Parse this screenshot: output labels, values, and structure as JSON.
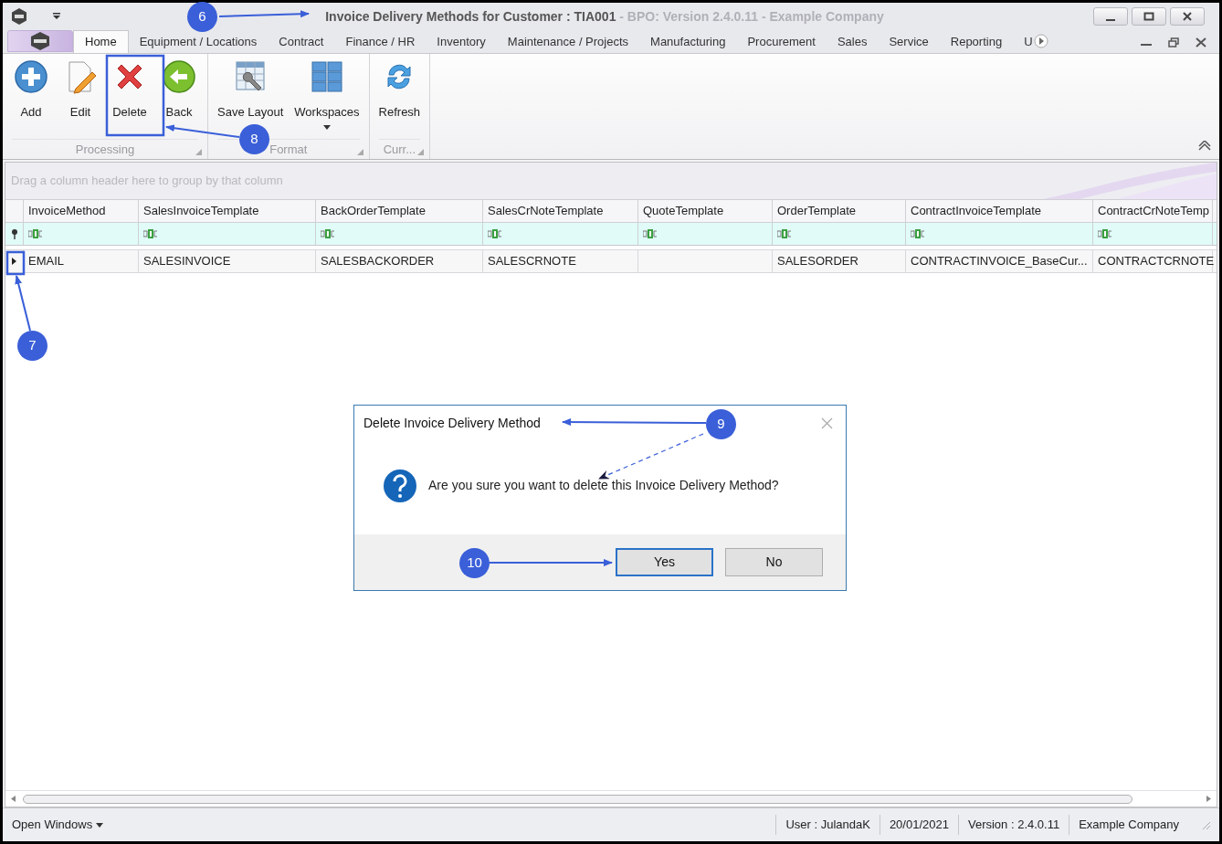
{
  "window": {
    "title": "Invoice Delivery Methods for Customer : TIA001",
    "subtitle": " - BPO: Version 2.4.0.11 - Example Company"
  },
  "tabs": [
    {
      "label": "Home",
      "selected": true
    },
    {
      "label": "Equipment / Locations",
      "selected": false
    },
    {
      "label": "Contract",
      "selected": false
    },
    {
      "label": "Finance / HR",
      "selected": false
    },
    {
      "label": "Inventory",
      "selected": false
    },
    {
      "label": "Maintenance / Projects",
      "selected": false
    },
    {
      "label": "Manufacturing",
      "selected": false
    },
    {
      "label": "Procurement",
      "selected": false
    },
    {
      "label": "Sales",
      "selected": false
    },
    {
      "label": "Service",
      "selected": false
    },
    {
      "label": "Reporting",
      "selected": false
    },
    {
      "label": "U",
      "selected": false
    }
  ],
  "ribbon": {
    "groups": [
      {
        "label": "Processing",
        "buttons": [
          {
            "label": "Add",
            "dropdown": false
          },
          {
            "label": "Edit",
            "dropdown": false
          },
          {
            "label": "Delete",
            "dropdown": false
          },
          {
            "label": "Back",
            "dropdown": false
          }
        ]
      },
      {
        "label": "Format",
        "buttons": [
          {
            "label": "Save Layout",
            "dropdown": false
          },
          {
            "label": "Workspaces",
            "dropdown": true
          }
        ]
      },
      {
        "label": "Curr...",
        "buttons": [
          {
            "label": "Refresh",
            "dropdown": false
          }
        ]
      }
    ]
  },
  "group_panel": {
    "placeholder": "Drag a column header here to group by that column"
  },
  "table": {
    "columns": [
      "InvoiceMethod",
      "SalesInvoiceTemplate",
      "BackOrderTemplate",
      "SalesCrNoteTemplate",
      "QuoteTemplate",
      "OrderTemplate",
      "ContractInvoiceTemplate",
      "ContractCrNoteTemp"
    ],
    "rows": [
      {
        "selected": true,
        "cells": [
          "EMAIL",
          "SALESINVOICE",
          "SALESBACKORDER",
          "SALESCRNOTE",
          "",
          "SALESORDER",
          "CONTRACTINVOICE_BaseCur...",
          "CONTRACTCRNOTE"
        ]
      }
    ]
  },
  "dialog": {
    "title": "Delete Invoice Delivery Method",
    "message": "Are you sure you want to delete this Invoice Delivery Method?",
    "buttons": [
      {
        "label": "Yes",
        "focused": true
      },
      {
        "label": "No",
        "focused": false
      }
    ]
  },
  "annotations": [
    {
      "label": "6"
    },
    {
      "label": "7"
    },
    {
      "label": "8"
    },
    {
      "label": "9"
    },
    {
      "label": "10"
    }
  ],
  "status_bar": {
    "open_windows": "Open Windows",
    "items": [
      "User : JulandaK",
      "20/01/2021",
      "Version : 2.4.0.11",
      "Example Company"
    ]
  }
}
